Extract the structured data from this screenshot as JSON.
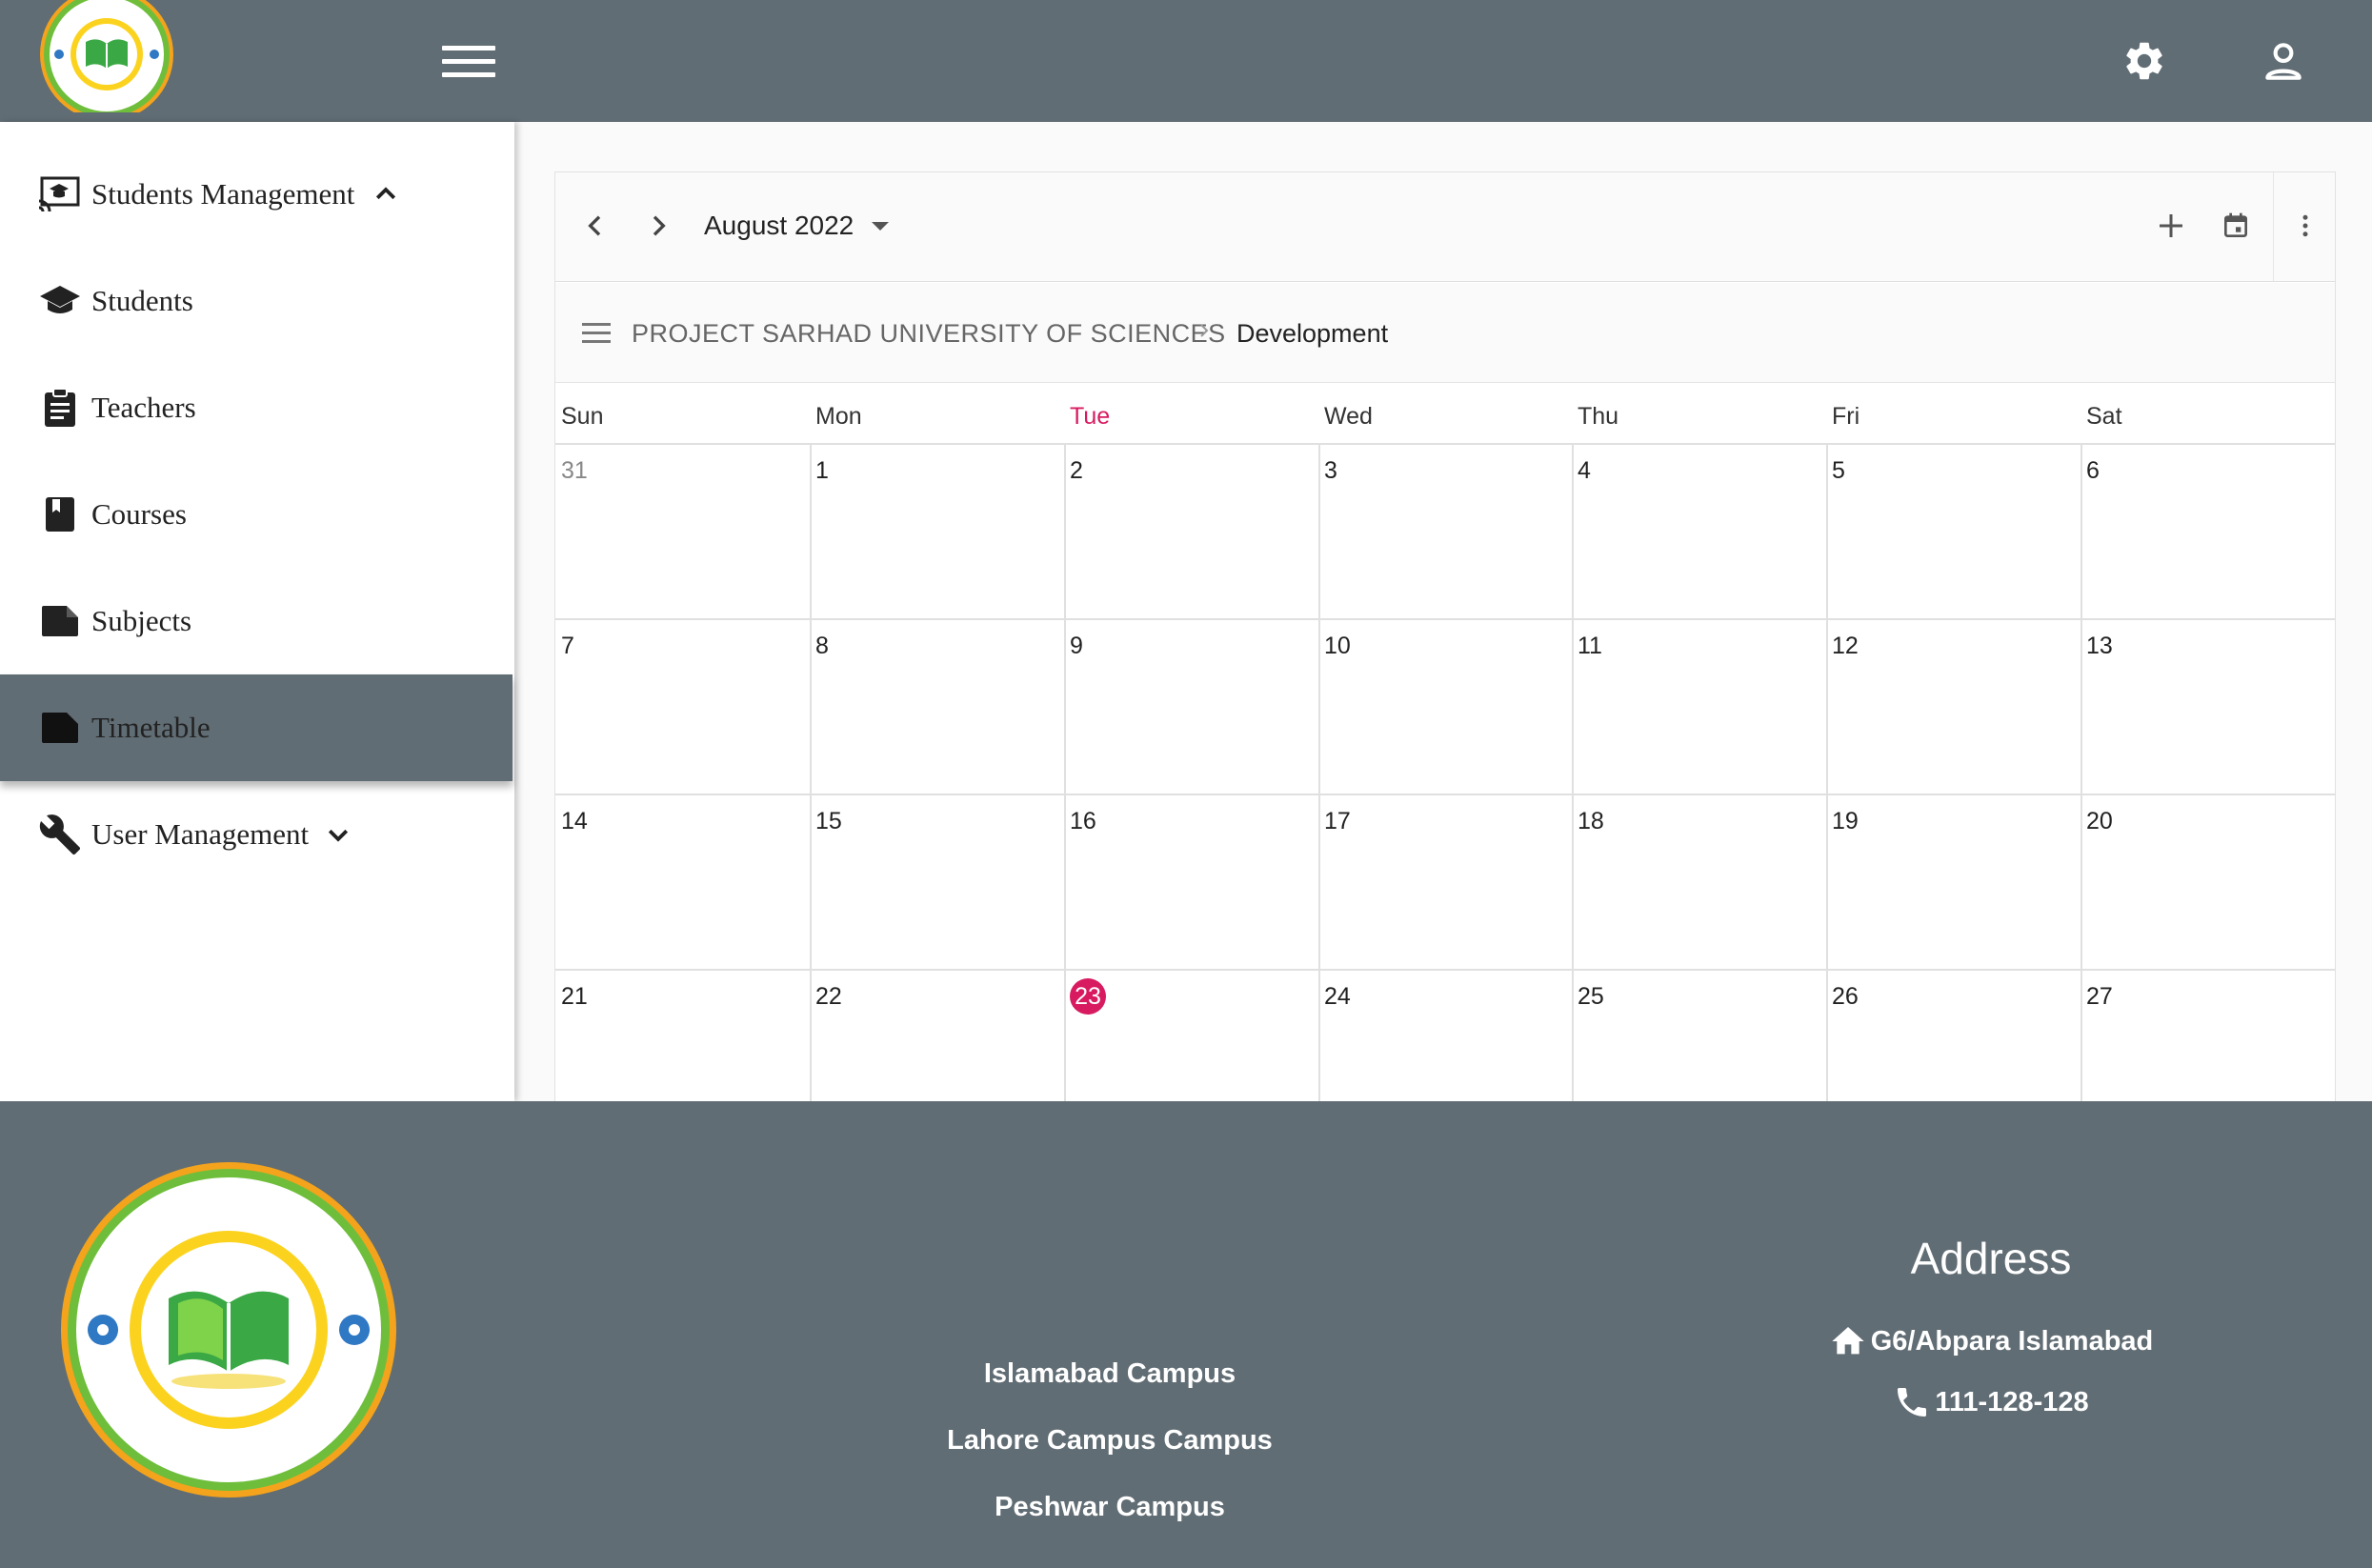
{
  "header": {
    "logo_icon": "school-seal-logo",
    "menu_icon": "hamburger-menu-icon",
    "settings_icon": "gear-icon",
    "account_icon": "account-icon"
  },
  "sidebar": {
    "items": [
      {
        "label": "Students Management",
        "icon": "cast-for-education-icon",
        "expandable": true,
        "expanded": true
      },
      {
        "label": "Students",
        "icon": "graduation-cap-icon"
      },
      {
        "label": "Teachers",
        "icon": "clipboard-icon"
      },
      {
        "label": "Courses",
        "icon": "book-icon"
      },
      {
        "label": "Subjects",
        "icon": "note-icon"
      },
      {
        "label": "Timetable",
        "icon": "note-icon",
        "active": true
      },
      {
        "label": "User Management",
        "icon": "wrench-icon",
        "expandable": true,
        "expanded": false
      }
    ]
  },
  "calendar": {
    "month_label": "August 2022",
    "breadcrumb": [
      "PROJECT SARHAD UNIVERSITY OF SCIENCES",
      "Development"
    ],
    "weekdays": [
      "Sun",
      "Mon",
      "Tue",
      "Wed",
      "Thu",
      "Fri",
      "Sat"
    ],
    "today_weekday_index": 2,
    "weeks": [
      [
        "31",
        "1",
        "2",
        "3",
        "4",
        "5",
        "6"
      ],
      [
        "7",
        "8",
        "9",
        "10",
        "11",
        "12",
        "13"
      ],
      [
        "14",
        "15",
        "16",
        "17",
        "18",
        "19",
        "20"
      ],
      [
        "21",
        "22",
        "23",
        "24",
        "25",
        "26",
        "27"
      ]
    ],
    "today": "23",
    "other_month_days": [
      "31"
    ],
    "accent_color": "#d81b60"
  },
  "footer": {
    "campuses": [
      "Islamabad Campus",
      "Lahore Campus Campus",
      "Peshwar Campus"
    ],
    "address_title": "Address",
    "address": "G6/Abpara Islamabad",
    "phone": "111-128-128"
  },
  "colors": {
    "header_bg": "#616d74",
    "footer_bg": "#616d74",
    "active_nav_bg": "#616d74",
    "today": "#d81b60"
  }
}
